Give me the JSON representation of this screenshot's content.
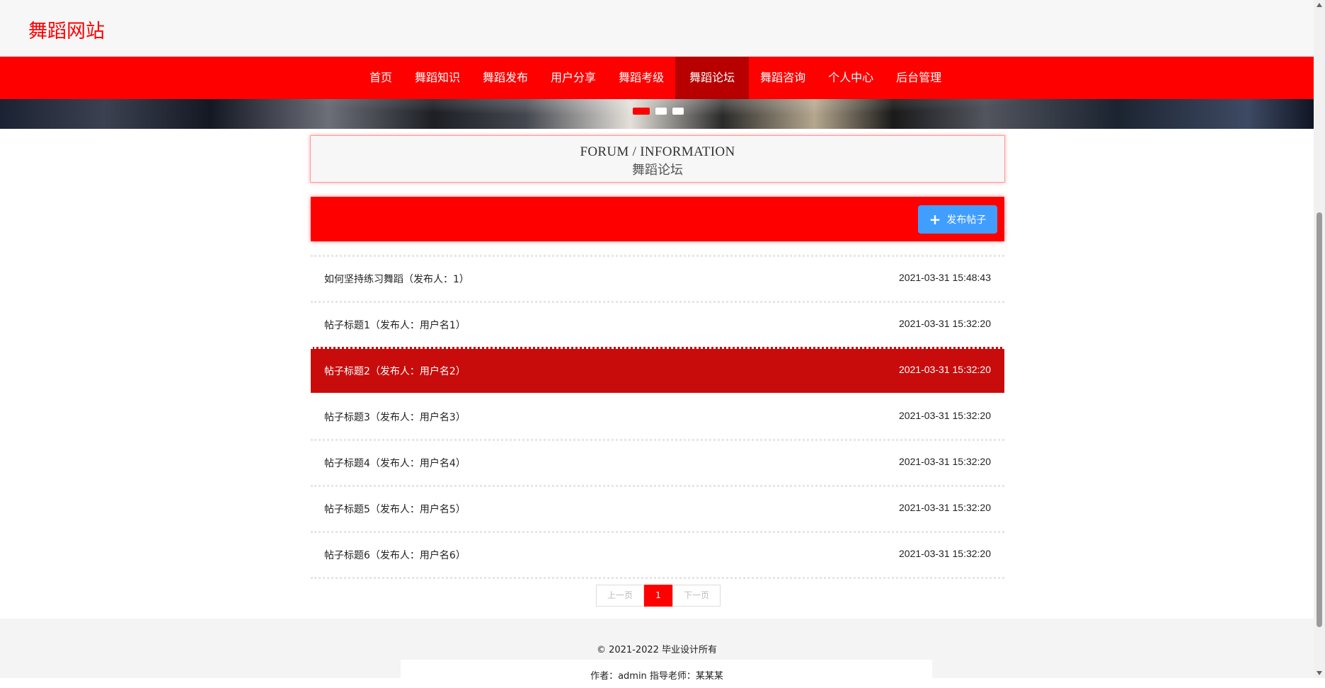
{
  "site": {
    "brand": "舞蹈网站"
  },
  "nav": {
    "items": [
      {
        "label": "首页"
      },
      {
        "label": "舞蹈知识"
      },
      {
        "label": "舞蹈发布"
      },
      {
        "label": "用户分享"
      },
      {
        "label": "舞蹈考级"
      },
      {
        "label": "舞蹈论坛",
        "active": true
      },
      {
        "label": "舞蹈咨询"
      },
      {
        "label": "个人中心"
      },
      {
        "label": "后台管理"
      }
    ]
  },
  "banner": {
    "slide_count": 3,
    "active_slide": 1
  },
  "section": {
    "title_en": "FORUM / INFORMATION",
    "title_cn": "舞蹈论坛"
  },
  "actions": {
    "publish_label": "发布帖子"
  },
  "posts": [
    {
      "title": "如何坚持练习舞蹈（发布人：1）",
      "time": "2021-03-31 15:48:43"
    },
    {
      "title": "帖子标题1（发布人：用户名1）",
      "time": "2021-03-31 15:32:20"
    },
    {
      "title": "帖子标题2（发布人：用户名2）",
      "time": "2021-03-31 15:32:20",
      "highlighted": true
    },
    {
      "title": "帖子标题3（发布人：用户名3）",
      "time": "2021-03-31 15:32:20"
    },
    {
      "title": "帖子标题4（发布人：用户名4）",
      "time": "2021-03-31 15:32:20"
    },
    {
      "title": "帖子标题5（发布人：用户名5）",
      "time": "2021-03-31 15:32:20"
    },
    {
      "title": "帖子标题6（发布人：用户名6）",
      "time": "2021-03-31 15:32:20"
    }
  ],
  "pagination": {
    "prev_label": "上一页",
    "current_page": "1",
    "next_label": "下一页"
  },
  "footer": {
    "copyright": "© 2021-2022 毕业设计所有",
    "author": "作者：admin 指导老师：某某某"
  },
  "colors": {
    "primary": "#ff0000",
    "active_nav": "#b80000",
    "highlight_row": "#c80c0c",
    "button_blue": "#409eff"
  }
}
